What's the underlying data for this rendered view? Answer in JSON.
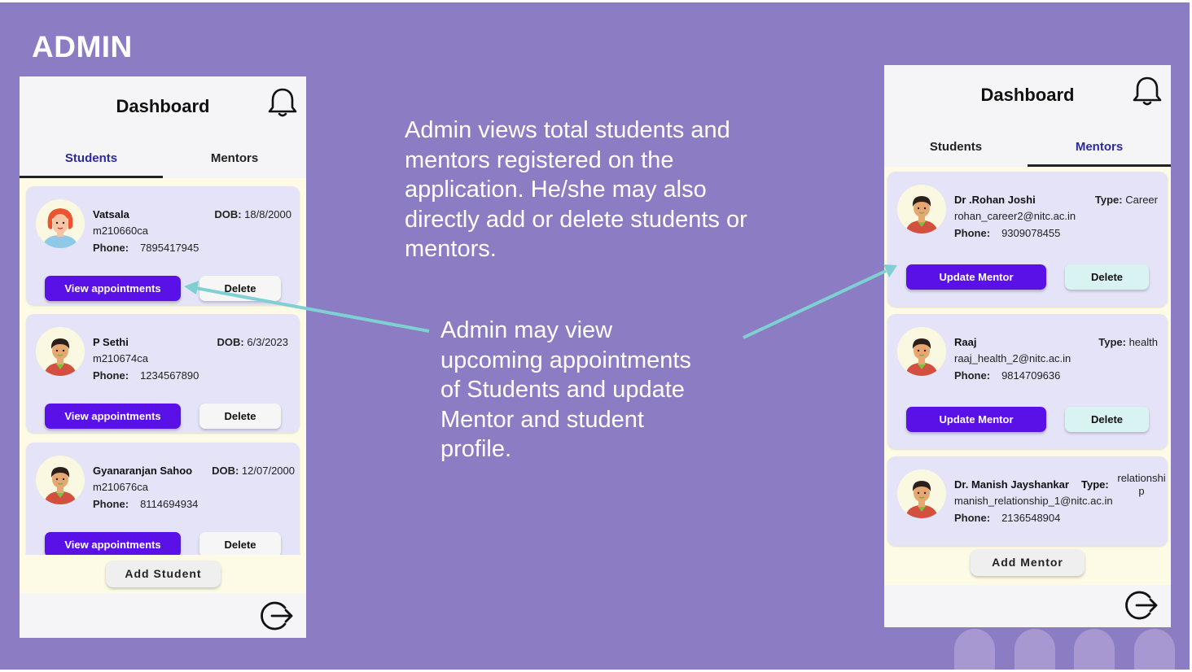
{
  "slide": {
    "title": "ADMIN",
    "caption_top": [
      "Admin views total students and",
      "mentors registered on the",
      "application. He/she may also",
      "directly add or delete students or",
      "mentors."
    ],
    "caption_middle": [
      "Admin may view",
      "upcoming appointments",
      "of Students and update",
      "Mentor and student",
      "profile."
    ]
  },
  "colors": {
    "slide_bg": "#8c7cc3",
    "primary_button": "#5a11e8",
    "arrow": "#7fd0d3",
    "card_bg": "#e4e3f8",
    "list_bg": "#fdfbe6"
  },
  "students_screen": {
    "title": "Dashboard",
    "tabs": [
      {
        "label": "Students",
        "active": true
      },
      {
        "label": "Mentors",
        "active": false
      }
    ],
    "students": [
      {
        "name": "Vatsala",
        "dob_label": "DOB:",
        "dob": "18/8/2000",
        "id": "m210660ca",
        "phone_label": "Phone:",
        "phone": "7895417945",
        "avatar": "female-avatar-icon",
        "view_label": "View appointments",
        "delete_label": "Delete"
      },
      {
        "name": "P Sethi",
        "dob_label": "DOB:",
        "dob": "6/3/2023",
        "id": "m210674ca",
        "phone_label": "Phone:",
        "phone": "1234567890",
        "avatar": "male-avatar-icon",
        "view_label": "View appointments",
        "delete_label": "Delete"
      },
      {
        "name": "Gyanaranjan Sahoo",
        "dob_label": "DOB:",
        "dob": "12/07/2000",
        "id": "m210676ca",
        "phone_label": "Phone:",
        "phone": "8114694934",
        "avatar": "male-avatar-icon",
        "view_label": "View appointments",
        "delete_label": "Delete"
      }
    ],
    "add_label": "Add Student"
  },
  "mentors_screen": {
    "title": "Dashboard",
    "tabs": [
      {
        "label": "Students",
        "active": false
      },
      {
        "label": "Mentors",
        "active": true
      }
    ],
    "mentors": [
      {
        "name": "Dr .Rohan Joshi",
        "type_label": "Type:",
        "type": "Career",
        "email": "rohan_career2@nitc.ac.in",
        "phone_label": "Phone:",
        "phone": "9309078455",
        "avatar": "male-avatar-icon",
        "update_label": "Update Mentor",
        "delete_label": "Delete"
      },
      {
        "name": "Raaj",
        "type_label": "Type:",
        "type": "health",
        "email": "raaj_health_2@nitc.ac.in",
        "phone_label": "Phone:",
        "phone": "9814709636",
        "avatar": "male-avatar-icon",
        "update_label": "Update Mentor",
        "delete_label": "Delete"
      },
      {
        "name": "Dr. Manish Jayshankar",
        "type_label": "Type:",
        "type_line1": "relationshi",
        "type_line2": "p",
        "email": "manish_relationship_1@nitc.ac.in",
        "phone_label": "Phone:",
        "phone": "2136548904",
        "avatar": "male-avatar-icon"
      }
    ],
    "add_label": "Add Mentor"
  },
  "icons": [
    "bell-icon",
    "logout-icon",
    "arrow-icon"
  ]
}
